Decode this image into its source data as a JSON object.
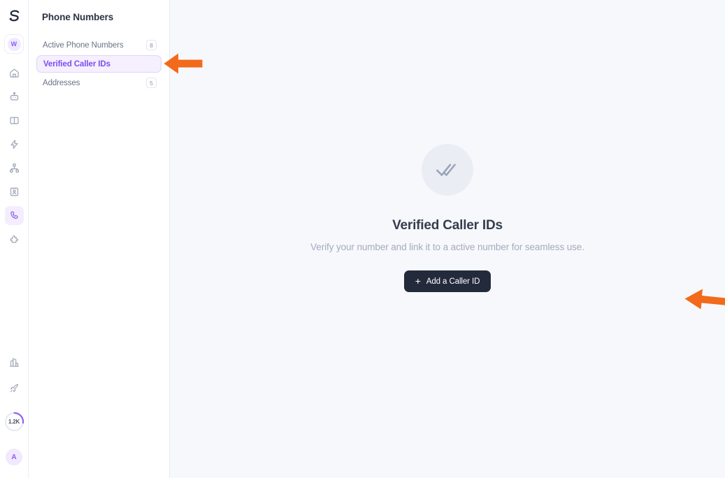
{
  "app": {
    "logo": "logo-s-icon",
    "workspace_initial": "W",
    "accent": "#8b5cf6",
    "annotation_color": "#f26a1b"
  },
  "rail": {
    "items": [
      {
        "icon": "home-icon",
        "name": "home",
        "active": false
      },
      {
        "icon": "bot-icon",
        "name": "agents",
        "active": false
      },
      {
        "icon": "book-icon",
        "name": "knowledge",
        "active": false
      },
      {
        "icon": "bolt-icon",
        "name": "actions",
        "active": false
      },
      {
        "icon": "workflow-icon",
        "name": "workflows",
        "active": false
      },
      {
        "icon": "contact-card-icon",
        "name": "contacts",
        "active": false
      },
      {
        "icon": "phone-icon",
        "name": "phone-numbers",
        "active": true
      },
      {
        "icon": "puzzle-icon",
        "name": "integrations",
        "active": false
      }
    ],
    "bottom": [
      {
        "icon": "building-icon",
        "name": "organization"
      },
      {
        "icon": "rocket-icon",
        "name": "upgrade"
      }
    ],
    "usage_ring": {
      "label": "1.2K",
      "percent": 27
    },
    "avatar_initial": "A"
  },
  "sidebar": {
    "title": "Phone Numbers",
    "items": [
      {
        "label": "Active Phone Numbers",
        "badge": "8",
        "active": false
      },
      {
        "label": "Verified Caller IDs",
        "badge": "",
        "active": true
      },
      {
        "label": "Addresses",
        "badge": "5",
        "active": false
      }
    ]
  },
  "main": {
    "empty_state": {
      "icon": "double-check-icon",
      "title": "Verified Caller IDs",
      "subtitle": "Verify your number and link it to a active number for seamless use.",
      "button_plus": "+",
      "button_label": "Add a Caller ID"
    }
  },
  "annotations": [
    {
      "name": "arrow-to-verified-caller-ids",
      "direction": "left"
    },
    {
      "name": "arrow-to-add-caller-id-button",
      "direction": "left"
    }
  ]
}
